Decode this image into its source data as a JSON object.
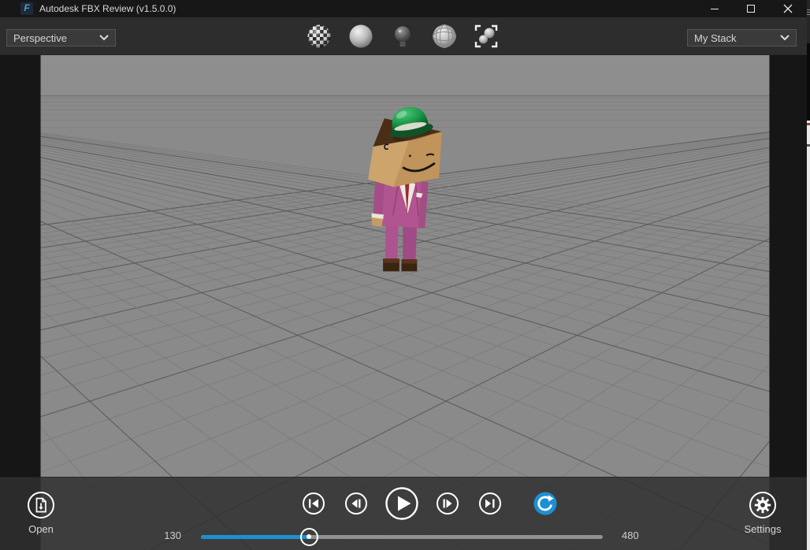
{
  "window": {
    "title": "Autodesk FBX Review (v1.5.0.0)",
    "app_icon_glyph": "F",
    "controls": [
      "minimize",
      "maximize",
      "close"
    ]
  },
  "toolbar": {
    "view_selector": {
      "value": "Perspective"
    },
    "stack_selector": {
      "value": "My Stack"
    },
    "icons": [
      {
        "name": "textured-display-icon"
      },
      {
        "name": "shaded-display-icon"
      },
      {
        "name": "lighting-icon"
      },
      {
        "name": "wireframe-display-icon"
      },
      {
        "name": "frame-selection-icon"
      }
    ]
  },
  "viewport": {
    "content": "3d character: box-headed man in pink suit with green bowler hat standing on grid ground plane"
  },
  "playback": {
    "open": {
      "label": "Open"
    },
    "settings": {
      "label": "Settings"
    },
    "buttons": [
      "go-to-start",
      "previous-frame",
      "play",
      "next-frame",
      "go-to-end",
      "loop"
    ],
    "timeline": {
      "start_frame": "130",
      "end_frame": "480",
      "progress_fraction": 0.27
    }
  },
  "colors": {
    "accent_blue": "#1b8fd3",
    "titlebar": "#171717",
    "toolbar": "#2d2d2d",
    "playbar": "#3a3a3a",
    "viewport_sky": "#8e8e8e",
    "viewport_ground": "#8a8a8a",
    "grid_minor": "#777777",
    "grid_major": "#5d5d5d"
  }
}
